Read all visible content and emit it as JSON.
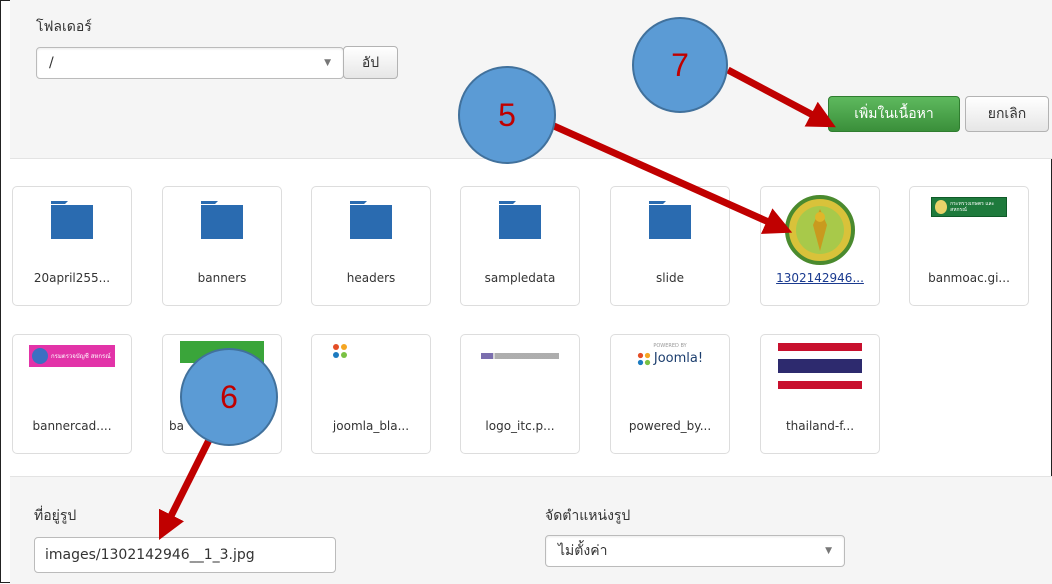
{
  "folder_section": {
    "label": "โฟลเดอร์",
    "folder_select_value": "/",
    "up_button": "อัป"
  },
  "actions": {
    "insert_button": "เพิ่มในเนื้อหา",
    "cancel_button": "ยกเลิก"
  },
  "media_items_row1": [
    {
      "name": "20april255...",
      "type": "folder"
    },
    {
      "name": "banners",
      "type": "folder"
    },
    {
      "name": "headers",
      "type": "folder"
    },
    {
      "name": "sampledata",
      "type": "folder"
    },
    {
      "name": "slide",
      "type": "folder"
    },
    {
      "name": "1302142946...",
      "type": "image",
      "thumb": "royal-seal-icon"
    },
    {
      "name": "banmoac.gi...",
      "type": "image",
      "thumb": "banner-icon"
    }
  ],
  "media_items_row2": [
    {
      "name": "bannercad....",
      "type": "image",
      "thumb": "banner-icon"
    },
    {
      "name": "ba",
      "type": "image",
      "thumb": "banner-icon"
    },
    {
      "name": "joomla_bla...",
      "type": "image",
      "thumb": "joomla-icon"
    },
    {
      "name": "logo_itc.p...",
      "type": "image",
      "thumb": "logo-icon"
    },
    {
      "name": "powered_by...",
      "type": "image",
      "thumb": "joomla-icon"
    },
    {
      "name": "thailand-f...",
      "type": "image",
      "thumb": "flag-icon"
    }
  ],
  "image_settings": {
    "url_label": "ที่อยู่รูป",
    "url_value": "images/1302142946__1_3.jpg",
    "align_label": "จัดตำแหน่งรูป",
    "align_value": "ไม่ตั้งค่า"
  },
  "thumb_texts": {
    "banmoac": "กระทรวงเกษตร และสหกรณ์",
    "bannercad": "กรมตรวจบัญชี สหกรณ์",
    "joomla": "Joomla!",
    "powered_by": "POWERED BY"
  },
  "callouts": [
    {
      "number": "5"
    },
    {
      "number": "6"
    },
    {
      "number": "7"
    }
  ],
  "colors": {
    "callout_fill": "#5b9bd5",
    "callout_text": "#c00000",
    "arrow": "#c00000",
    "primary_button": "#46a546",
    "folder": "#2a6bb0"
  }
}
